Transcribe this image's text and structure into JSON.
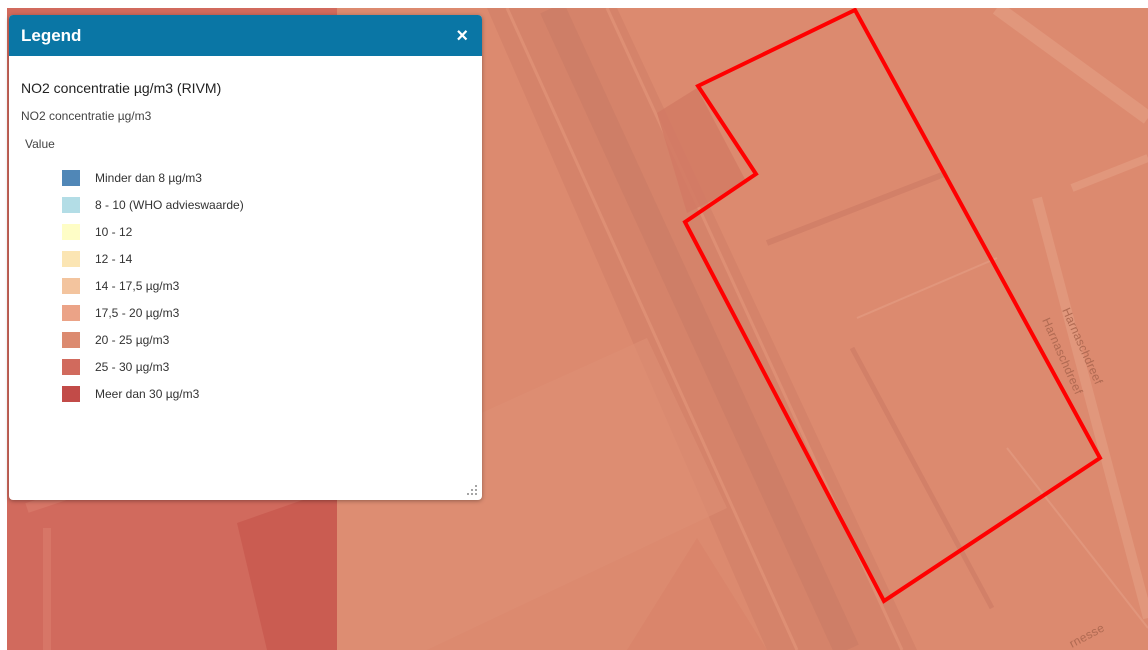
{
  "legend": {
    "title": "Legend",
    "close_symbol": "×",
    "layer_title": "NO2 concentratie µg/m3 (RIVM)",
    "layer_subtitle": "NO2 concentratie µg/m3",
    "field_label": "Value",
    "items": [
      {
        "label": "Minder dan 8 µg/m3",
        "color": "#5087b7"
      },
      {
        "label": "8 - 10 (WHO advieswaarde)",
        "color": "#b3dde6"
      },
      {
        "label": "10 - 12",
        "color": "#fefdc6"
      },
      {
        "label": "12 - 14",
        "color": "#fbe5b3"
      },
      {
        "label": "14 - 17,5 µg/m3",
        "color": "#f3c49e"
      },
      {
        "label": "17,5 - 20 µg/m3",
        "color": "#eba387"
      },
      {
        "label": "20 - 25 µg/m3",
        "color": "#dc8a6f"
      },
      {
        "label": "25 - 30 µg/m3",
        "color": "#d16a5d"
      },
      {
        "label": "Meer dan 30 µg/m3",
        "color": "#c24b48"
      }
    ],
    "icons": {
      "close": "close-icon",
      "resize": "resize-handle-icon"
    }
  },
  "map": {
    "road_labels": [
      "Harnaschdreef",
      "Harnaschdreef"
    ],
    "partial_label": "rnesse",
    "colors": {
      "base": "#dc8a6f",
      "dark_zone": "#d16a5d",
      "highlight_outline": "#ff0000"
    }
  }
}
